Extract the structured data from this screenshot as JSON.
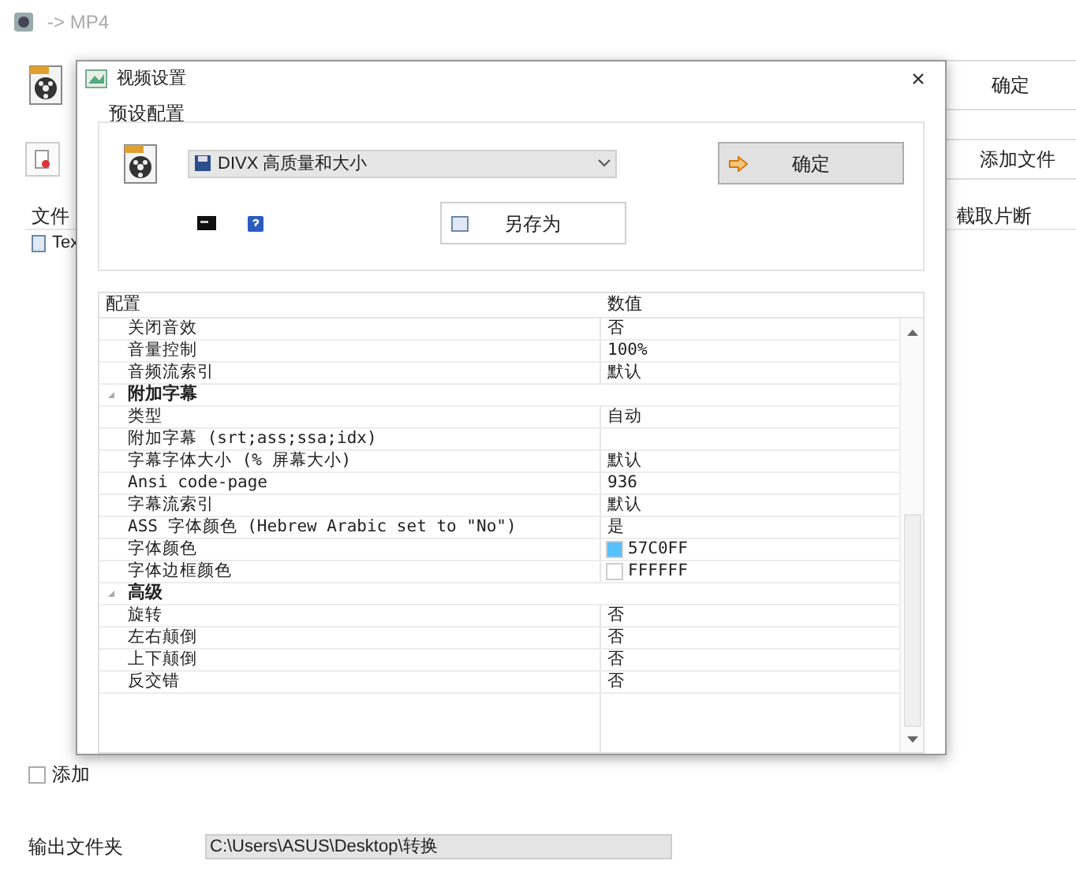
{
  "main_window": {
    "title": "-> MP4",
    "ok_button": "确定",
    "add_file_button": "添加文件",
    "columns": [
      "文件",
      "截取片断"
    ],
    "files": [
      {
        "name": "Tex"
      }
    ],
    "checkbox": {
      "label": "添加",
      "checked": false
    },
    "output_folder": {
      "label": "输出文件夹",
      "value": "C:\\Users\\ASUS\\Desktop\\转换"
    }
  },
  "dialog": {
    "title": "视频设置",
    "preset_group": {
      "label": "预设配置",
      "preset": "DIVX 高质量和大小",
      "ok_button": "确定",
      "save_as_button": "另存为"
    },
    "grid": {
      "columns": [
        "配置",
        "数值"
      ],
      "rows": [
        {
          "kind": "item",
          "name": "关闭音效",
          "value": "否"
        },
        {
          "kind": "item",
          "name": "音量控制",
          "value": "100%"
        },
        {
          "kind": "item",
          "name": "音频流索引",
          "value": "默认"
        },
        {
          "kind": "group",
          "name": "附加字幕",
          "expanded": true
        },
        {
          "kind": "item",
          "name": "类型",
          "value": "自动"
        },
        {
          "kind": "item",
          "name": "附加字幕 (srt;ass;ssa;idx)"
        },
        {
          "kind": "item",
          "name": "字幕字体大小 (% 屏幕大小)",
          "value": "默认"
        },
        {
          "kind": "item",
          "name": "Ansi code-page",
          "value": "936"
        },
        {
          "kind": "item",
          "name": "字幕流索引",
          "value": "默认"
        },
        {
          "kind": "item",
          "name": "ASS 字体颜色 (Hebrew Arabic set to \"No\")",
          "value": "是"
        },
        {
          "kind": "swatch",
          "name": "字体颜色",
          "value": "57C0FF",
          "color": "#57c0ff"
        },
        {
          "kind": "swatch",
          "name": "字体边框颜色",
          "value": "FFFFFF",
          "color": "#ffffff"
        },
        {
          "kind": "group",
          "name": "高级",
          "expanded": true
        },
        {
          "kind": "item",
          "name": "旋转",
          "value": "否"
        },
        {
          "kind": "item",
          "name": "左右颠倒",
          "value": "否"
        },
        {
          "kind": "item",
          "name": "上下颠倒",
          "value": "否"
        },
        {
          "kind": "item",
          "name": "反交错",
          "value": "否"
        }
      ]
    }
  }
}
